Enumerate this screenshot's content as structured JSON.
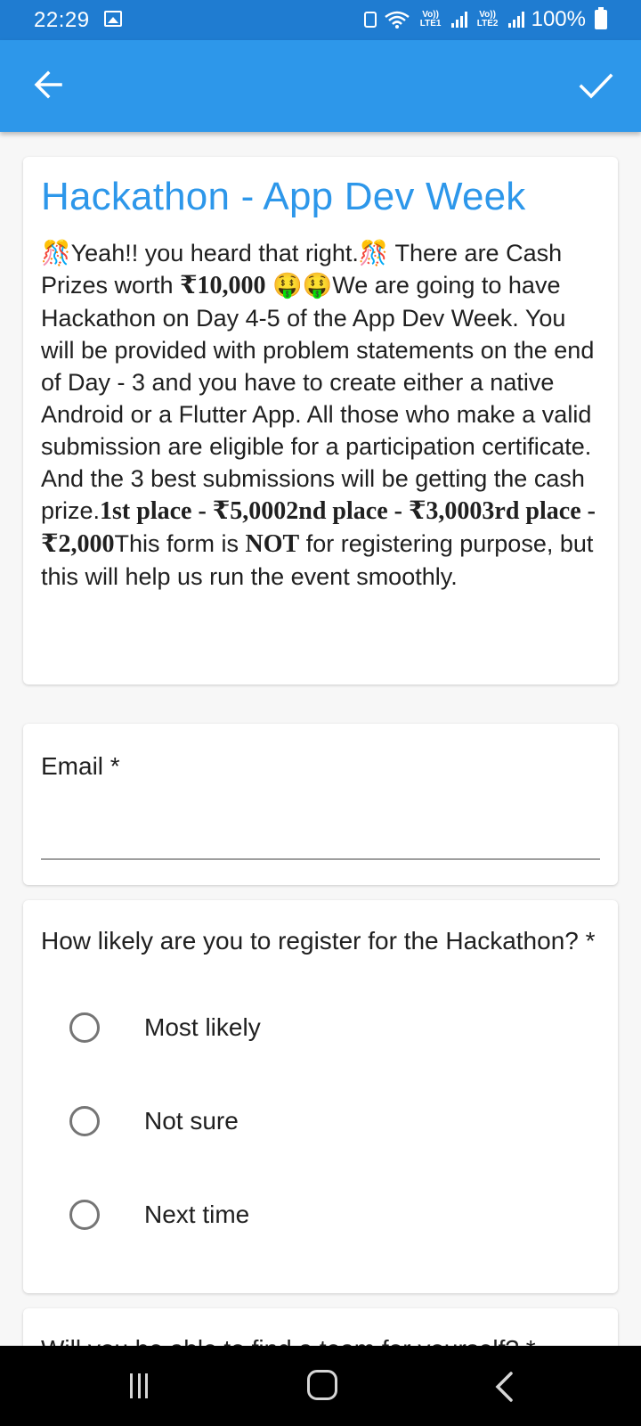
{
  "status_bar": {
    "time": "22:29",
    "network_1": "Vo)) LTE1",
    "network_2": "Vo)) LTE2",
    "battery": "100%"
  },
  "app_bar": {
    "back_icon": "arrow-left-icon",
    "confirm_icon": "check-icon"
  },
  "intro": {
    "title": "Hackathon - App Dev Week",
    "emoji_celebrate": "🎊",
    "emoji_money": "🤑",
    "text_1": "Yeah!! you heard that right.",
    "text_2": " There are Cash Prizes worth ",
    "prize_total": "₹10,000",
    "text_3": "We are going to have Hackathon on Day 4-5 of the App Dev Week. You will be provided with problem statements on the end of Day - 3 and you have to create either a native Android or a Flutter App. All those who make a valid submission are eligible for a participation certificate. And the 3 best submissions will be getting the cash prize.",
    "places": "1st place - ₹5,0002nd place - ₹3,0003rd place - ₹2,000",
    "text_4": "This form is ",
    "not": "NOT",
    "text_5": " for registering purpose, but this will help us run the event smoothly."
  },
  "email_question": {
    "label": "Email *",
    "value": ""
  },
  "likely_question": {
    "label": "How likely are you to register for the Hackathon? *",
    "options": [
      "Most likely",
      "Not sure",
      "Next time"
    ]
  },
  "team_question": {
    "label": "Will you be able to find a team for yourself? *"
  },
  "nav_bar": {
    "recents_icon": "recents-icon",
    "home_icon": "home-icon",
    "back_icon": "back-chevron-icon"
  }
}
